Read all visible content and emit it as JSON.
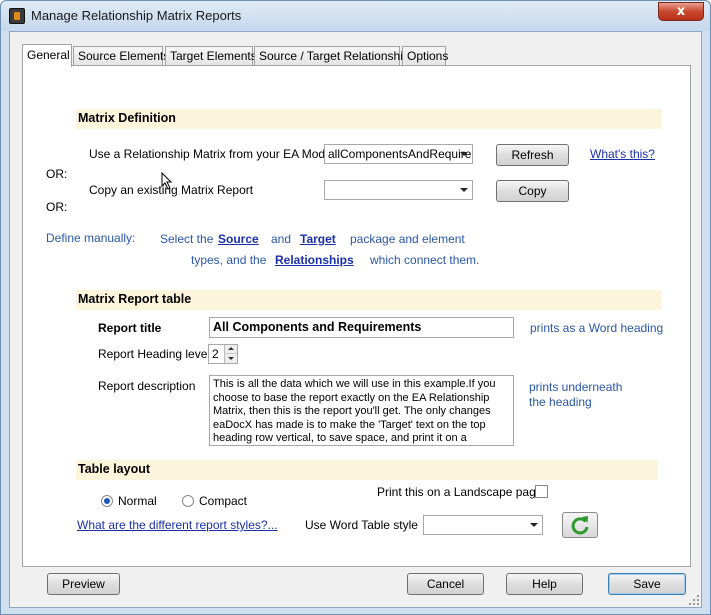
{
  "window": {
    "title": "Manage Relationship Matrix Reports",
    "close_label": "x"
  },
  "tabs": [
    {
      "label": "General",
      "active": true
    },
    {
      "label": "Source Elements",
      "active": false
    },
    {
      "label": "Target Elements",
      "active": false
    },
    {
      "label": "Source / Target Relationship",
      "active": false
    },
    {
      "label": "Options",
      "active": false
    }
  ],
  "matrix_definition": {
    "heading": "Matrix Definition",
    "use_matrix_label": "Use a Relationship Matrix from your EA Model:",
    "use_matrix_value": "allComponentsAndRequirements",
    "refresh_label": "Refresh",
    "whats_this_label": "What's this?",
    "or_label_1": "OR:",
    "copy_existing_label": "Copy an existing Matrix Report",
    "copy_existing_value": "",
    "copy_label": "Copy",
    "or_label_2": "OR:",
    "define_manually_label": "Define manually:",
    "select_the": "Select the",
    "source_link": "Source",
    "and_label": "and",
    "target_link": "Target",
    "package_and_element": "package and element",
    "types_and_the": "types, and the",
    "relationships_link": "Relationships",
    "which_connect_them": "which connect them."
  },
  "matrix_report_table": {
    "heading": "Matrix Report table",
    "report_title_label": "Report title",
    "report_title_value": "All Components and Requirements",
    "report_title_hint": "prints as a Word heading",
    "heading_level_label": "Report Heading level",
    "heading_level_value": "2",
    "description_label": "Report description",
    "description_value": "This is all the data which we will use in this example.If you choose to base the report exactly on the EA Relationship Matrix, then this is the report you'll get. The only changes eaDocX has made is to make the  'Target' text on the top heading row vertical, to save space, and print it on a",
    "description_hint_1": "prints underneath",
    "description_hint_2": "the heading"
  },
  "table_layout": {
    "heading": "Table layout",
    "normal_label": "Normal",
    "normal_checked": true,
    "compact_label": "Compact",
    "compact_checked": false,
    "landscape_label": "Print this on a Landscape page",
    "landscape_checked": false,
    "styles_link": "What are the different report styles?...",
    "word_table_style_label": "Use Word Table style",
    "word_table_style_value": ""
  },
  "footer": {
    "preview_label": "Preview",
    "cancel_label": "Cancel",
    "help_label": "Help",
    "save_label": "Save"
  },
  "colors": {
    "section_bar": "#fdf4dc",
    "link": "#1a2fa8",
    "hint_text": "#2a57a8",
    "refresh_icon": "#2e9a2e"
  }
}
